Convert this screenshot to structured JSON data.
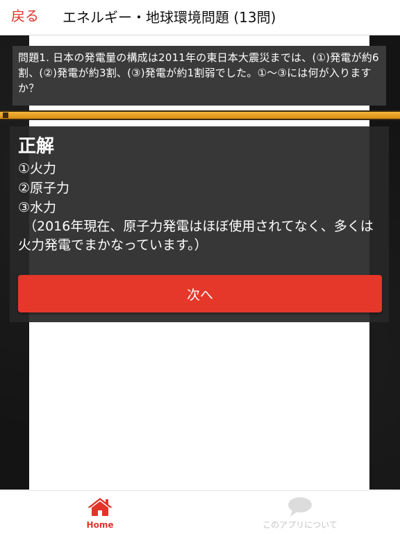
{
  "header": {
    "back_label": "戻る",
    "title": "エネルギー・地球環境問題 (13問)"
  },
  "question": {
    "text": "問題1. 日本の発電量の構成は2011年の東日本大震災までは、(①)発電が約6割、(②)発電が約3割、(③)発電が約1割弱でした。①～③には何が入りますか？"
  },
  "progress": {
    "fraction": 1.0
  },
  "answer": {
    "heading": "正解",
    "lines": [
      "①火力",
      "②原子力",
      "③水力"
    ],
    "note": "（2016年現在、原子力発電はほぼ使用されてなく、多くは火力発電でまかなっています。）"
  },
  "next_button": {
    "label": "次へ"
  },
  "tab_bar": {
    "tabs": [
      {
        "label": "Home",
        "icon": "home-icon",
        "active": true
      },
      {
        "label": "このアプリについて",
        "icon": "speech-bubble-icon",
        "active": false
      }
    ]
  },
  "colors": {
    "accent": "#e2352a",
    "button": "#e5372a",
    "progress": "#e39c1f"
  }
}
